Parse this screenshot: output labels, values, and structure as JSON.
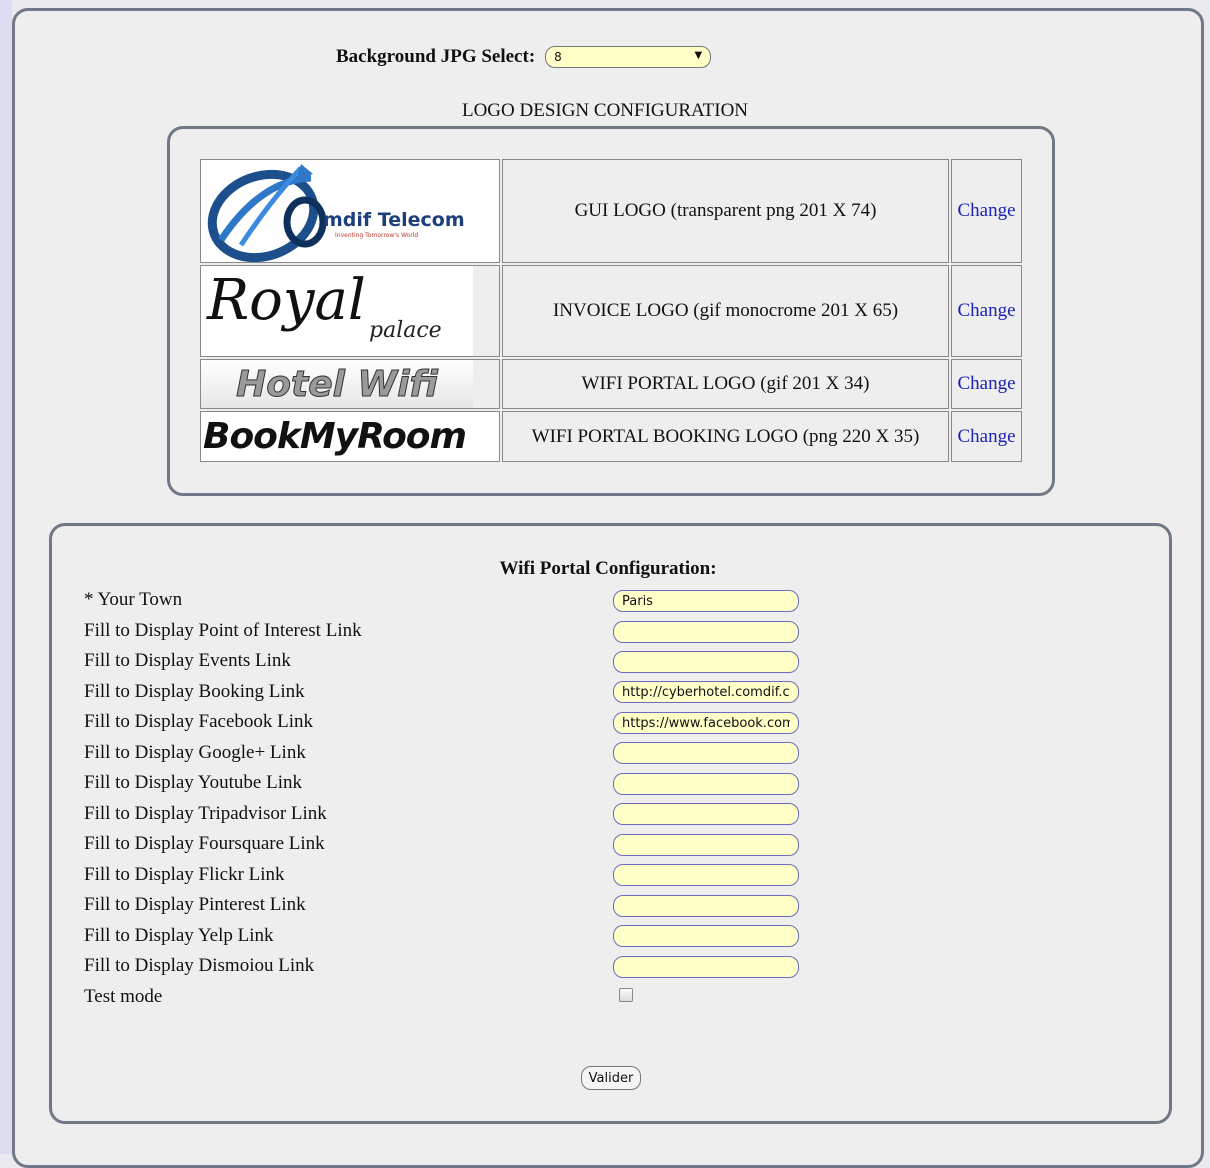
{
  "background_select": {
    "label": "Background JPG Select:",
    "value": "8"
  },
  "logo_section": {
    "title": "LOGO DESIGN CONFIGURATION",
    "rows": [
      {
        "logo_text": "mdif Telecom",
        "logo_tagline": "Inventing Tomorrow's World",
        "description": "GUI LOGO (transparent png 201 X 74)",
        "action": "Change"
      },
      {
        "logo_text": "Royal",
        "logo_tagline": "palace",
        "description": "INVOICE LOGO (gif monocrome 201 X 65)",
        "action": "Change"
      },
      {
        "logo_text": "Hotel Wifi",
        "description": "WIFI PORTAL LOGO (gif 201 X 34)",
        "action": "Change"
      },
      {
        "logo_text": "BookMyRoom",
        "description": "WIFI PORTAL BOOKING LOGO (png 220 X 35)",
        "action": "Change"
      }
    ]
  },
  "wifi_config": {
    "title": "Wifi Portal Configuration:",
    "fields": [
      {
        "label": "* Your Town",
        "value": "Paris"
      },
      {
        "label": "Fill to Display Point of Interest Link",
        "value": ""
      },
      {
        "label": "Fill to Display Events Link",
        "value": ""
      },
      {
        "label": "Fill to Display Booking Link",
        "value": "http://cyberhotel.comdif.c"
      },
      {
        "label": "Fill to Display Facebook Link",
        "value": "https://www.facebook.com"
      },
      {
        "label": "Fill to Display Google+ Link",
        "value": ""
      },
      {
        "label": "Fill to Display Youtube Link",
        "value": ""
      },
      {
        "label": "Fill to Display Tripadvisor Link",
        "value": ""
      },
      {
        "label": "Fill to Display Foursquare Link",
        "value": ""
      },
      {
        "label": "Fill to Display Flickr Link",
        "value": ""
      },
      {
        "label": "Fill to Display Pinterest Link",
        "value": ""
      },
      {
        "label": "Fill to Display Yelp Link",
        "value": ""
      },
      {
        "label": "Fill to Display Dismoiou Link",
        "value": ""
      }
    ],
    "test_mode_label": "Test mode",
    "submit_label": "Valider"
  },
  "colors": {
    "input_bg": "#ffffc8",
    "link": "#1a22b8",
    "panel_border": "#6f7884"
  }
}
